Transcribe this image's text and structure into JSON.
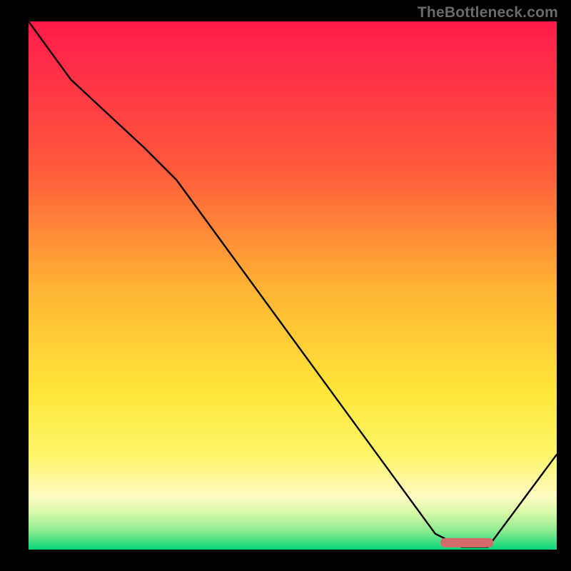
{
  "watermark": "TheBottleneck.com",
  "chart_data": {
    "type": "line",
    "title": "",
    "xlabel": "",
    "ylabel": "",
    "xlim": [
      0,
      100
    ],
    "ylim": [
      0,
      100
    ],
    "grid": false,
    "series": [
      {
        "name": "curve",
        "x": [
          0,
          8,
          22,
          28,
          77,
          82,
          87,
          100
        ],
        "y": [
          100,
          89,
          76,
          70,
          3,
          0.5,
          0.5,
          18
        ]
      }
    ],
    "marker": {
      "name": "target-range",
      "x0": 78,
      "x1": 88,
      "y": 1.3
    },
    "background_gradient": {
      "stops": [
        {
          "offset": 0.0,
          "color": "#ff1a4b"
        },
        {
          "offset": 0.28,
          "color": "#ff5a3c"
        },
        {
          "offset": 0.5,
          "color": "#ffb233"
        },
        {
          "offset": 0.7,
          "color": "#ffe63a"
        },
        {
          "offset": 0.82,
          "color": "#fff568"
        },
        {
          "offset": 0.9,
          "color": "#fdfac2"
        },
        {
          "offset": 0.93,
          "color": "#d9f9a8"
        },
        {
          "offset": 0.965,
          "color": "#8beb8f"
        },
        {
          "offset": 1.0,
          "color": "#09d67a"
        }
      ]
    }
  }
}
